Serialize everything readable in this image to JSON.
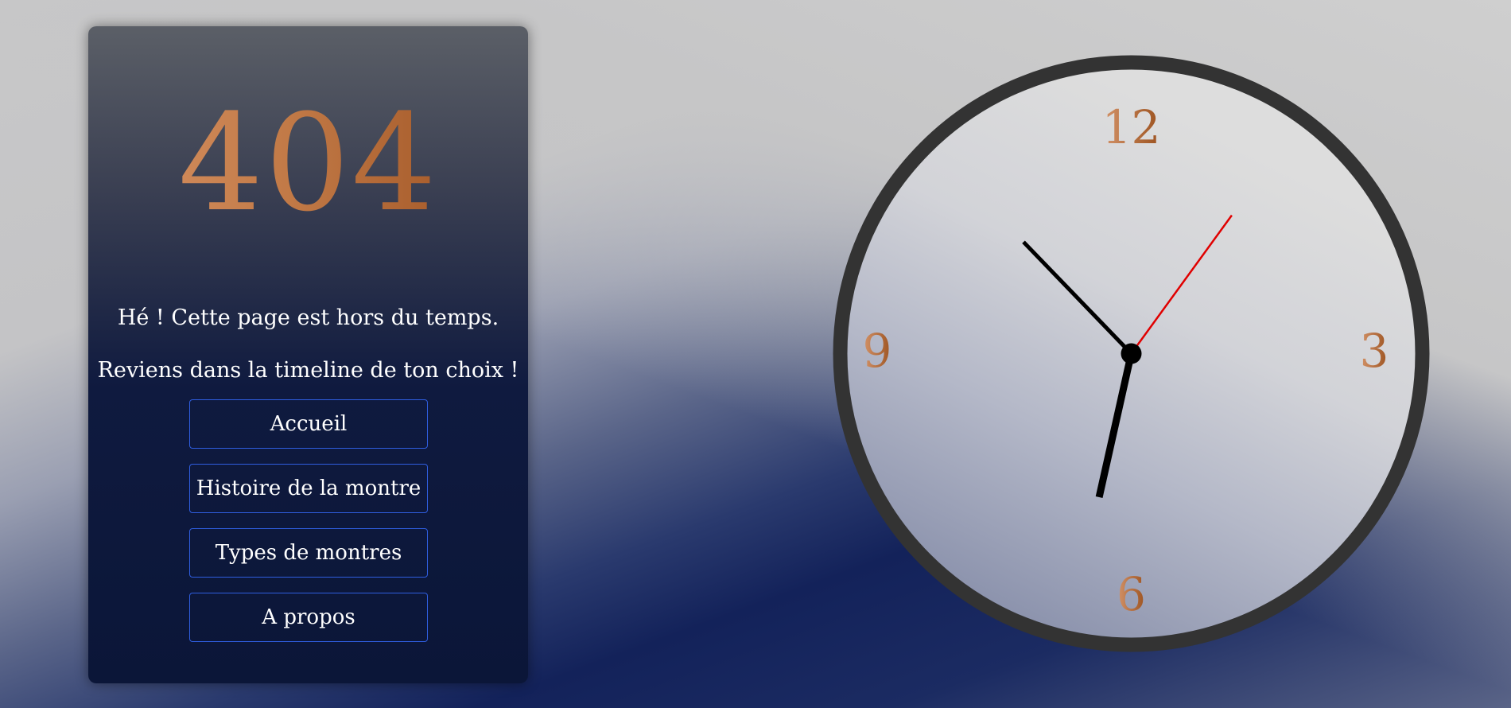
{
  "page": {
    "error_code": "404",
    "message_line1": "Hé ! Cette page est hors du temps.",
    "message_line2": "Reviens dans la timeline de ton choix !"
  },
  "nav": {
    "home": "Accueil",
    "history": "Histoire de la montre",
    "types": "Types de montres",
    "about": "A propos"
  },
  "clock": {
    "numerals": {
      "twelve": "12",
      "three": "3",
      "six": "6",
      "nine": "9"
    },
    "time": {
      "hours": 10,
      "minutes": 32,
      "seconds": 6
    },
    "colors": {
      "numeral": "#c17a48",
      "second_hand": "#e00000",
      "hands": "#000000",
      "rim": "#333333",
      "face": "#dcdcdd"
    }
  },
  "colors": {
    "accent_copper": "#c27a47",
    "button_border": "#2f5ee0",
    "card_dark": "#0b1638"
  }
}
